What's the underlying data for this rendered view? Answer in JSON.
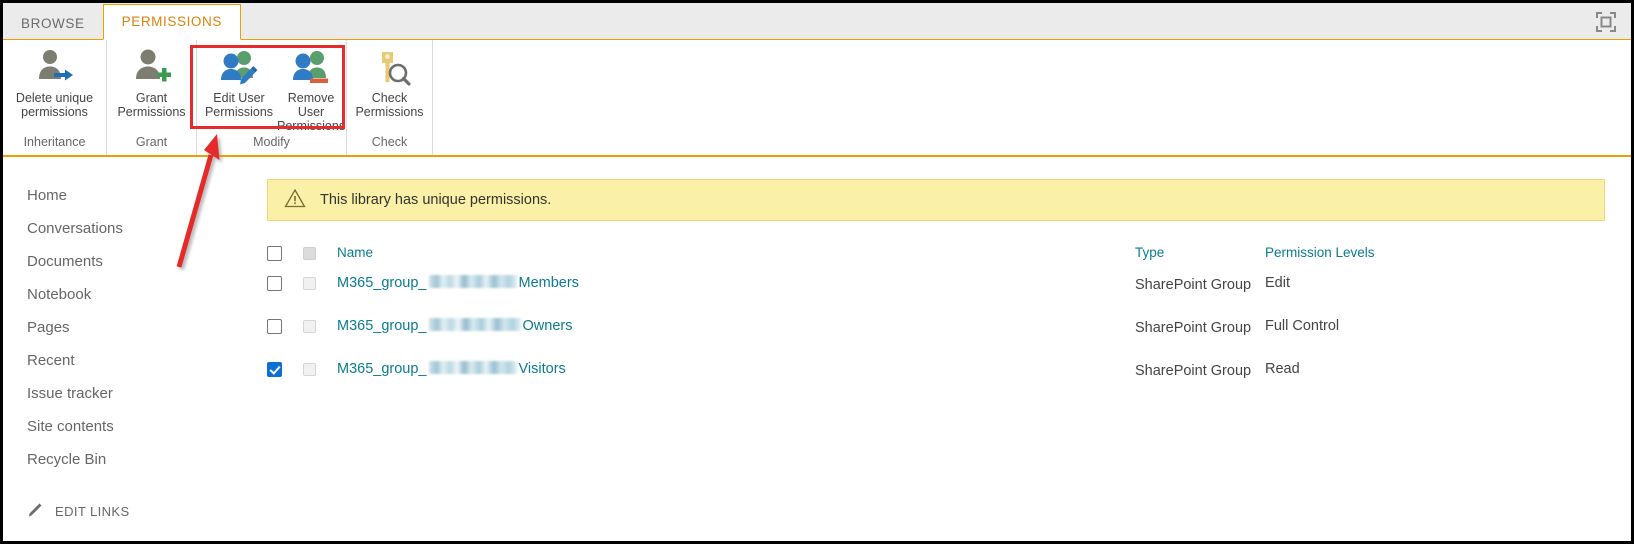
{
  "window": {
    "expand_icon": "focus-on-content-icon"
  },
  "ribbon": {
    "tabs": [
      {
        "label": "BROWSE",
        "active": false
      },
      {
        "label": "PERMISSIONS",
        "active": true
      }
    ],
    "groups": [
      {
        "label": "Inheritance",
        "buttons": [
          {
            "label": "Delete unique permissions",
            "icon": "delete-unique-permissions-icon"
          }
        ]
      },
      {
        "label": "Grant",
        "buttons": [
          {
            "label": "Grant Permissions",
            "icon": "grant-permissions-icon"
          }
        ]
      },
      {
        "label": "Modify",
        "buttons": [
          {
            "label": "Edit User Permissions",
            "icon": "edit-user-permissions-icon"
          },
          {
            "label": "Remove User Permissions",
            "icon": "remove-user-permissions-icon"
          }
        ]
      },
      {
        "label": "Check",
        "buttons": [
          {
            "label": "Check Permissions",
            "icon": "check-permissions-icon"
          }
        ]
      }
    ]
  },
  "sidebar": {
    "items": [
      {
        "label": "Home"
      },
      {
        "label": "Conversations"
      },
      {
        "label": "Documents"
      },
      {
        "label": "Notebook"
      },
      {
        "label": "Pages"
      },
      {
        "label": "Recent"
      },
      {
        "label": "Issue tracker"
      },
      {
        "label": "Site contents"
      },
      {
        "label": "Recycle Bin"
      }
    ],
    "edit_links": "EDIT LINKS"
  },
  "banner": {
    "icon": "warning-triangle-icon",
    "message": "This library has unique permissions."
  },
  "table": {
    "headers": {
      "name": "Name",
      "type": "Type",
      "levels": "Permission Levels"
    },
    "rows": [
      {
        "selected": false,
        "name_prefix": "M365_group_",
        "name_redacted": true,
        "name_suffix": "Members",
        "type": "SharePoint Group",
        "level": "Edit"
      },
      {
        "selected": false,
        "name_prefix": "M365_group_",
        "name_redacted": true,
        "name_suffix": "Owners",
        "type": "SharePoint Group",
        "level": "Full Control"
      },
      {
        "selected": true,
        "name_prefix": "M365_group_",
        "name_redacted": true,
        "name_suffix": "Visitors",
        "type": "SharePoint Group",
        "level": "Read"
      }
    ]
  },
  "annotations": {
    "highlight_color": "#e52b2b",
    "highlight_target": "Modify group (Edit User Permissions / Remove User Permissions)",
    "arrow_color": "#e52b2b"
  },
  "colors": {
    "accent_orange": "#e8a200",
    "tab_active_text": "#d8820c",
    "link_teal": "#0b7b8f",
    "checkbox_blue": "#0b6fd4",
    "banner_bg": "#fbf0a7",
    "ribbon_bg": "#ebebeb"
  }
}
